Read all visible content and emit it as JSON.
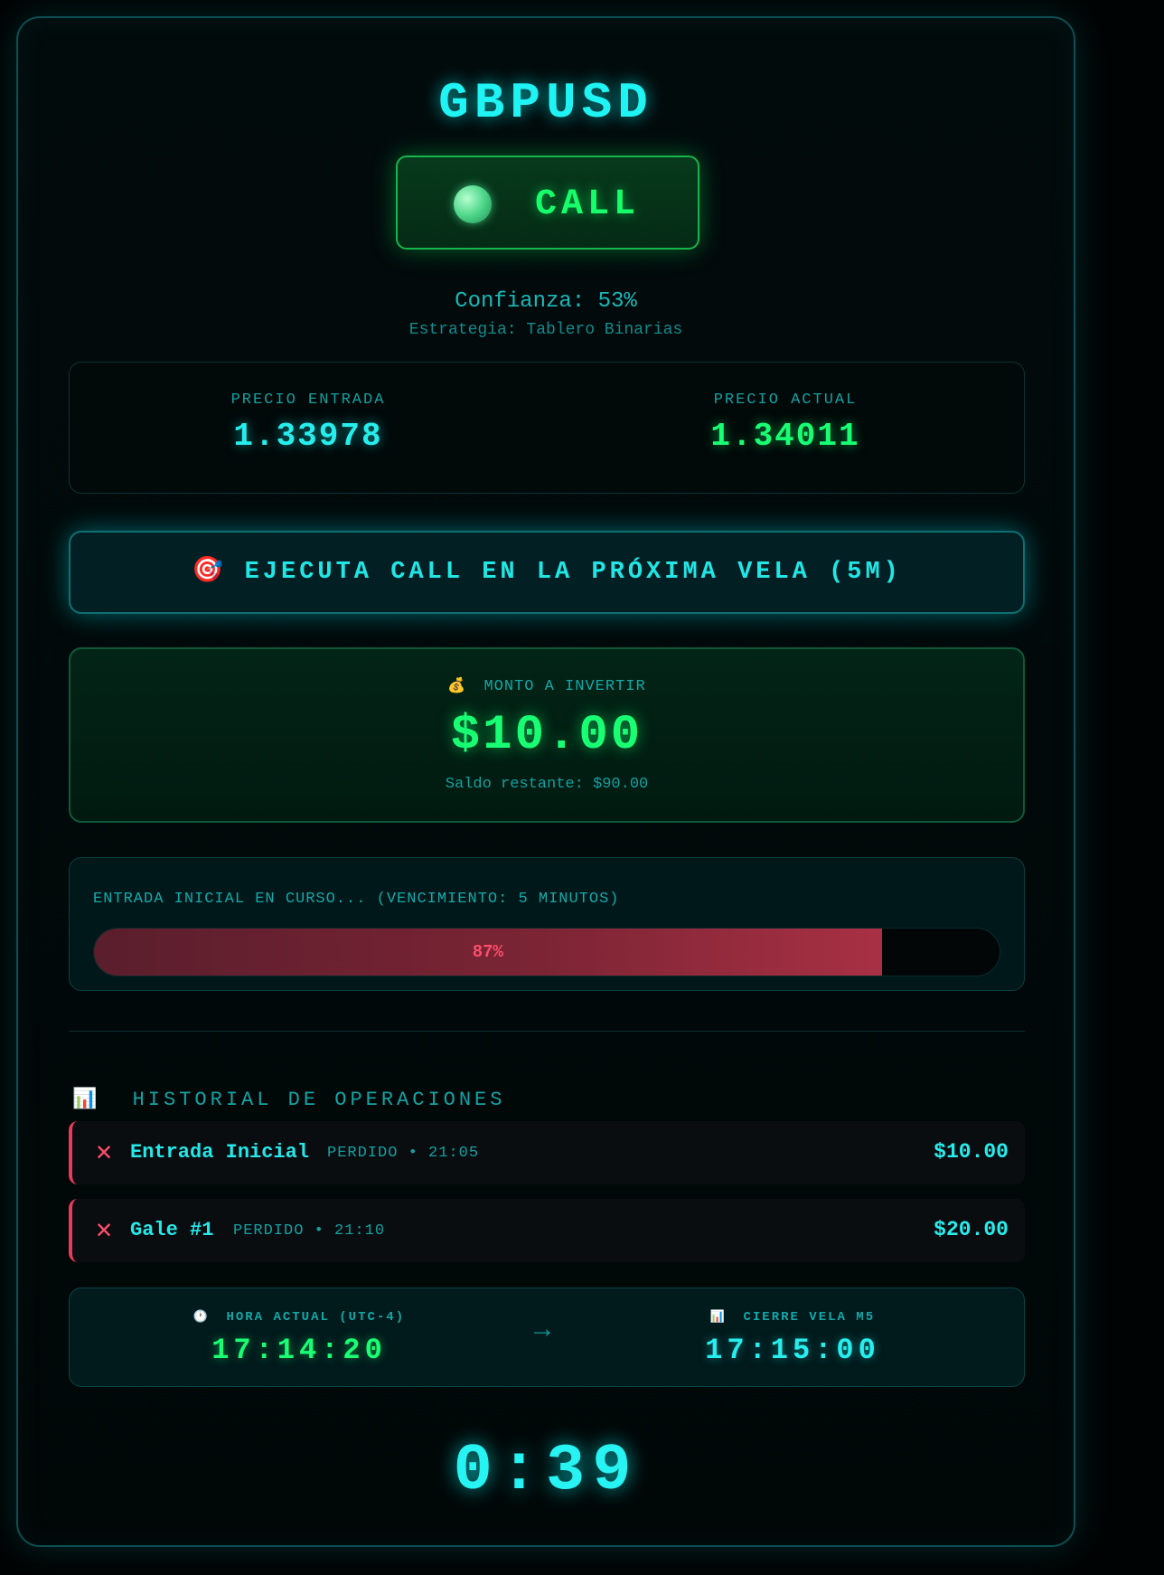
{
  "pair": "GBPUSD",
  "signal": {
    "direction": "CALL",
    "dot_color": "#4ed68a"
  },
  "confidence": "Confianza: 53%",
  "strategy": "Estrategia: Tablero Binarias",
  "prices": {
    "entry_label": "PRECIO ENTRADA",
    "entry_value": "1.33978",
    "current_label": "PRECIO ACTUAL",
    "current_value": "1.34011"
  },
  "execute": {
    "icon": "target-icon",
    "text": "EJECUTA CALL EN LA PRÓXIMA VELA (5M)"
  },
  "invest": {
    "icon": "money-bag-icon",
    "label": "MONTO A INVERTIR",
    "amount": "$10.00",
    "balance": "Saldo restante: $90.00"
  },
  "progress": {
    "label": "ENTRADA INICIAL EN CURSO... (VENCIMIENTO: 5 MINUTOS)",
    "percent_text": "87%",
    "percent": 87
  },
  "history": {
    "icon": "bar-chart-icon",
    "title": "HISTORIAL DE OPERACIONES",
    "items": [
      {
        "name": "Entrada Inicial",
        "meta": "PERDIDO • 21:05",
        "amount": "$10.00",
        "status_icon": "x-icon"
      },
      {
        "name": "Gale #1",
        "meta": "PERDIDO • 21:10",
        "amount": "$20.00",
        "status_icon": "x-icon"
      }
    ]
  },
  "time": {
    "current_icon": "clock-icon",
    "current_label": "HORA ACTUAL (UTC-4)",
    "current_value": "17:14:20",
    "arrow": "→",
    "close_icon": "chart-icon",
    "close_label": "CIERRE VELA M5",
    "close_value": "17:15:00"
  },
  "countdown": "0:39",
  "colors": {
    "accent_cyan": "#27eded",
    "accent_green": "#19ff74",
    "loss_red": "#ff4d6b"
  }
}
